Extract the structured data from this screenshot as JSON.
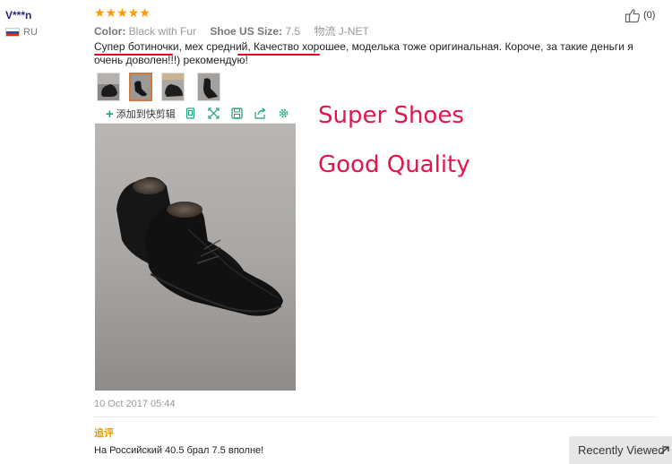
{
  "reviewer": {
    "name": "V***n",
    "country_code": "RU"
  },
  "rating": {
    "stars": "★★★★★",
    "value": 5,
    "max": 5
  },
  "attributes": {
    "color_label": "Color:",
    "color_value": "Black with Fur",
    "size_label": "Shoe US Size:",
    "size_value": "7.5",
    "logistics_label": "物流",
    "logistics_value": "J-NET"
  },
  "helpful": {
    "count": "(0)"
  },
  "review": {
    "segment1": "Супер ботиночки",
    "segment2": ", мех средний, ",
    "segment3": "Качество хорошее",
    "segment4": ", моделька тоже оригинальная. Короче, за такие деньги я очень доволен!!!) рекомендую!"
  },
  "toolbar": {
    "add_label": "添加到快剪辑"
  },
  "date": "10 Oct 2017 05:44",
  "followup": {
    "label": "追评",
    "text": "На Российский 40.5 брал 7.5 вполне!"
  },
  "annotations": {
    "line1": "Super Shoes",
    "line2": "Good Quality",
    "color": "#e4144d"
  },
  "recently_viewed": {
    "label": "Recently Viewed"
  },
  "colors": {
    "star": "#ff9a00",
    "underline": "#e60026",
    "followup": "#e5a000"
  }
}
